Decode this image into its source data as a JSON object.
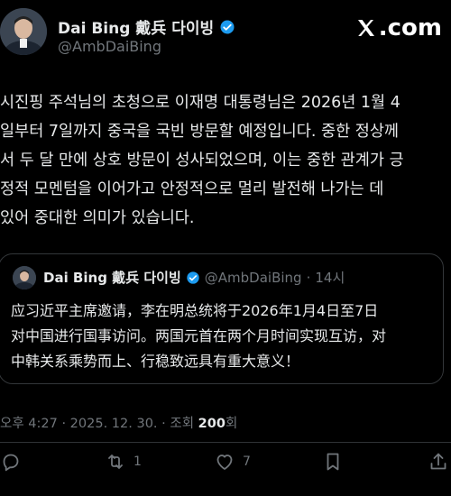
{
  "author": {
    "display_name": "Dai Bing 戴兵 다이빙",
    "handle": "@AmbDaiBing"
  },
  "brand": {
    "logo_text": ".com"
  },
  "post": {
    "lines": [
      "시진핑 주석님의 초청으로 이재명 대통령님은 2026년 1월 4",
      "일부터 7일까지 중국을 국빈 방문할 예정입니다. 중한 정상께",
      "서 두 달 만에 상호 방문이 성사되었으며, 이는 중한 관계가 긍",
      "정적 모멘텀을 이어가고 안정적으로 멀리 발전해 나가는 데",
      "있어 중대한 의미가 있습니다."
    ]
  },
  "quoted": {
    "display_name": "Dai Bing 戴兵 다이빙",
    "handle": "@AmbDaiBing",
    "separator": "·",
    "time": "14시",
    "lines": [
      "应习近平主席邀请，李在明总统将于2026年1月4日至7日",
      "对中国进行国事访问。两国元首在两个月时间实现互访，对",
      "中韩关系乘势而上、行稳致远具有重大意义！"
    ]
  },
  "meta": {
    "timestamp": "오후 4:27 · 2025. 12. 30. · 조회 ",
    "views": "200",
    "views_suffix": "회"
  },
  "actions": {
    "reply_count": "",
    "repost_count": "1",
    "like_count": "7"
  },
  "colors": {
    "background": "#000000",
    "verified": "#1d9bf0",
    "muted": "#71767b"
  }
}
